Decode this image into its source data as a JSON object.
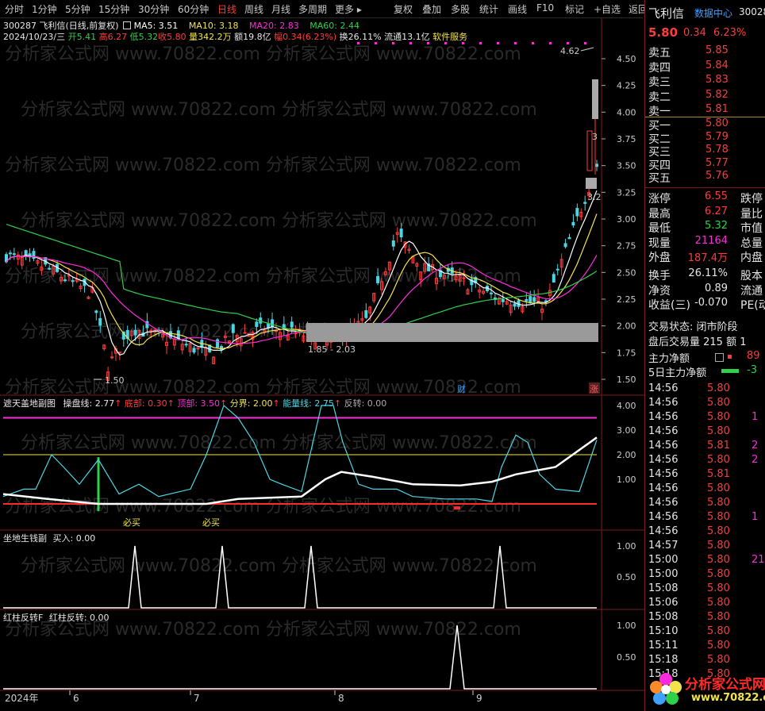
{
  "toolbar": {
    "periods": [
      "分时",
      "1分钟",
      "5分钟",
      "15分钟",
      "30分钟",
      "60分钟",
      "日线",
      "周线",
      "月线",
      "多周期",
      "更多"
    ],
    "active_period": "日线",
    "actions": [
      "复权",
      "叠加",
      "多股",
      "统计",
      "画线",
      "F10",
      "标记",
      "+自选",
      "返回"
    ]
  },
  "stock": {
    "code": "300287",
    "name": "飞利信",
    "mode": "(日线,前复权)",
    "date": "2024/10/23/三",
    "open": "开5.41",
    "high": "高6.27",
    "low": "低5.32",
    "close": "收5.80",
    "volume": "量342.2万",
    "amount": "额19.8亿",
    "range": "幅0.34(6.23%)",
    "turnover": "换26.11%",
    "float": "流通13.1亿",
    "sector": "软件服务"
  },
  "ma": {
    "ma5": "MA5: 3.51",
    "ma10": "MA10: 3.18",
    "ma20": "MA20: 2.83",
    "ma60": "MA60: 2.44",
    "colors": {
      "ma5": "#ffffff",
      "ma10": "#f2e34d",
      "ma20": "#ff2bdc",
      "ma60": "#2fd14a"
    }
  },
  "main_axis": [
    "4.50",
    "4.25",
    "4.00",
    "3.75",
    "3.50",
    "3.25",
    "3.00",
    "2.75",
    "2.50",
    "2.25",
    "2.00",
    "1.75",
    "1.50"
  ],
  "annotations": {
    "low_marker": "1.50",
    "zone_label": "1.85 - 2.03",
    "high_marker": "4.62",
    "finance_badge": "财",
    "rise_badge": "涨",
    "side_3": "3",
    "side_32": "3.2"
  },
  "ind1": {
    "title": "遮天盖地副图",
    "line1": "操盘线: 2.77",
    "line2": "底部: 0.30",
    "line3": "顶部: 3.50",
    "line4": "分界: 2.00",
    "line5": "能量线: 2.75",
    "line6": "反转: 0.00",
    "axis": [
      "4.00",
      "3.00",
      "2.00",
      "1.00"
    ],
    "buy_label": "必买"
  },
  "ind2": {
    "title": "坐地生钱副",
    "value": "买入: 0.00",
    "axis": [
      "1.00",
      "0.50"
    ]
  },
  "ind3": {
    "title": "红柱反转F",
    "value": "红柱反转: 0.00",
    "axis": [
      "1.00",
      "0.50"
    ]
  },
  "xaxis": [
    "2024年",
    "6",
    "7",
    "8",
    "9"
  ],
  "watermark": "分析家公式网 www.70822.com",
  "panel": {
    "name": "飞利信",
    "data_center": "数据中心",
    "code": "300287",
    "price": "5.80",
    "change": "0.34",
    "pct": "6.23%",
    "asks": [
      {
        "label": "卖五",
        "price": "5.85"
      },
      {
        "label": "卖四",
        "price": "5.84"
      },
      {
        "label": "卖三",
        "price": "5.83"
      },
      {
        "label": "卖二",
        "price": "5.82"
      },
      {
        "label": "卖一",
        "price": "5.81"
      }
    ],
    "bids": [
      {
        "label": "买一",
        "price": "5.80"
      },
      {
        "label": "买二",
        "price": "5.79"
      },
      {
        "label": "买三",
        "price": "5.78"
      },
      {
        "label": "买四",
        "price": "5.77"
      },
      {
        "label": "买五",
        "price": "5.76"
      }
    ],
    "stats": [
      {
        "label": "涨停",
        "value": "6.55",
        "color": "red",
        "right": "跌停"
      },
      {
        "label": "最高",
        "value": "6.27",
        "color": "red",
        "right": "量比"
      },
      {
        "label": "最低",
        "value": "5.32",
        "color": "green",
        "right": "市值"
      },
      {
        "label": "现量",
        "value": "21164",
        "color": "magenta",
        "right": "总量"
      },
      {
        "label": "外盘",
        "value": "187.4万",
        "color": "red",
        "right": "内盘"
      },
      {
        "label": "换手",
        "value": "26.11%",
        "color": "white",
        "right": "股本"
      },
      {
        "label": "净资",
        "value": "0.89",
        "color": "white",
        "right": "流通"
      },
      {
        "label": "收益(三)",
        "value": "-0.070",
        "color": "white",
        "right": "PE(动"
      }
    ],
    "trade_state": "交易状态: 闭市阶段",
    "after_hours": "盘后交易量 215  额 1",
    "main_flow": "主力净额",
    "main_flow_val": "89",
    "five_day_flow": "5日主力净额",
    "five_day_val": "-3",
    "ticks": [
      {
        "t": "14:56",
        "p": "5.80",
        "v": ""
      },
      {
        "t": "14:56",
        "p": "5.80",
        "v": ""
      },
      {
        "t": "14:56",
        "p": "5.80",
        "v": "1"
      },
      {
        "t": "14:56",
        "p": "5.80",
        "v": ""
      },
      {
        "t": "14:56",
        "p": "5.81",
        "v": "2"
      },
      {
        "t": "14:56",
        "p": "5.80",
        "v": "2"
      },
      {
        "t": "14:56",
        "p": "5.81",
        "v": ""
      },
      {
        "t": "14:56",
        "p": "5.80",
        "v": ""
      },
      {
        "t": "14:56",
        "p": "5.80",
        "v": ""
      },
      {
        "t": "14:56",
        "p": "5.80",
        "v": "1"
      },
      {
        "t": "14:56",
        "p": "5.80",
        "v": ""
      },
      {
        "t": "14:57",
        "p": "5.80",
        "v": ""
      },
      {
        "t": "15:00",
        "p": "5.80",
        "v": "21"
      },
      {
        "t": "15:00",
        "p": "5.80",
        "v": ""
      },
      {
        "t": "15:08",
        "p": "5.80",
        "v": ""
      },
      {
        "t": "15:06",
        "p": "5.80",
        "v": ""
      },
      {
        "t": "15:08",
        "p": "5.80",
        "v": ""
      },
      {
        "t": "15:10",
        "p": "5.80",
        "v": ""
      },
      {
        "t": "15:11",
        "p": "5.80",
        "v": ""
      },
      {
        "t": "15:18",
        "p": "5.80",
        "v": ""
      },
      {
        "t": "15:18",
        "p": "5.80",
        "v": ""
      }
    ],
    "logo_text": "分析家公式网",
    "logo_url": "www.70822.com"
  }
}
